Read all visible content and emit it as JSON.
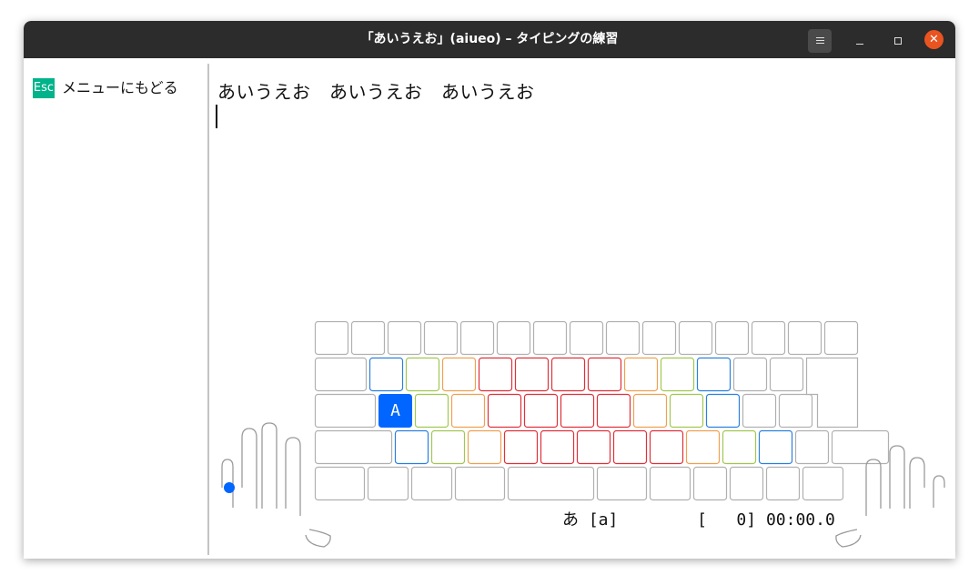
{
  "window": {
    "title": "「あいうえお」(aiueo) – タイピングの練習",
    "menu_icon": "hamburger-icon",
    "minimize_icon": "minimize-icon",
    "maximize_icon": "maximize-icon",
    "close_icon": "close-icon",
    "close_color": "#e95420"
  },
  "sidebar": {
    "esc_key": "Esc",
    "esc_label": "メニューにもどる",
    "esc_color": "#00b38a"
  },
  "prompt": {
    "text": "あいうえお　あいうえお　あいうえお",
    "typed": ""
  },
  "keyboard": {
    "highlighted_key": "A",
    "highlight_color": "#0066ff",
    "finger_colors": {
      "index": "#e0303a",
      "middle": "#f0a050",
      "ring": "#a0c850",
      "pinky": "#2a80e0",
      "neutral": "#b0b0b0"
    }
  },
  "status": {
    "char": "あ",
    "romaji": "[a]",
    "count": "[   0]",
    "time": "00:00.0"
  }
}
